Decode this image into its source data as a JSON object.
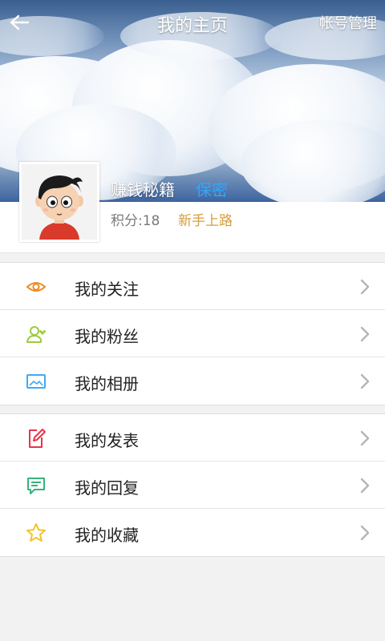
{
  "header": {
    "title": "我的主页",
    "account_manage": "帐号管理"
  },
  "profile": {
    "username": "赚钱秘籍",
    "gender": "保密",
    "points": "积分:18",
    "level": "新手上路"
  },
  "menu": {
    "group1": [
      {
        "label": "我的关注",
        "icon": "eye-icon",
        "color": "#f08a24"
      },
      {
        "label": "我的粉丝",
        "icon": "user-icon",
        "color": "#9ccc3a"
      },
      {
        "label": "我的相册",
        "icon": "image-icon",
        "color": "#3fa9f5"
      }
    ],
    "group2": [
      {
        "label": "我的发表",
        "icon": "edit-icon",
        "color": "#e8334a"
      },
      {
        "label": "我的回复",
        "icon": "comment-icon",
        "color": "#36b37e"
      },
      {
        "label": "我的收藏",
        "icon": "star-icon",
        "color": "#f4c22b"
      }
    ]
  }
}
